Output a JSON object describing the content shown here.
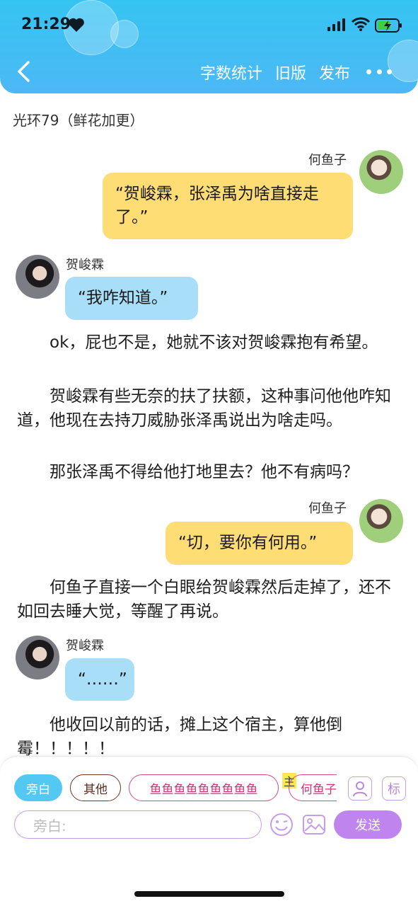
{
  "status_bar": {
    "time": "21:29"
  },
  "nav": {
    "links": [
      "字数统计",
      "旧版",
      "发布"
    ]
  },
  "chapter": {
    "title": "光环79（鲜花加更）"
  },
  "messages": [
    {
      "speaker": "何鱼子",
      "side": "right",
      "text": "“贺峻霖，张泽禹为啥直接走了。”"
    },
    {
      "speaker": "贺峻霖",
      "side": "left",
      "text": "“我咋知道。”"
    },
    {
      "speaker": "何鱼子",
      "side": "right",
      "text": "“切，要你有何用。”"
    },
    {
      "speaker": "贺峻霖",
      "side": "left",
      "text": "“……”"
    }
  ],
  "narration": [
    "ok，屁也不是，她就不该对贺峻霖抱有希望。",
    "贺峻霖有些无奈的扶了扶额，这种事问他他咋知道，他现在去持刀威胁张泽禹说出为啥走吗。",
    "那张泽禹不得给他打地里去？他不有病吗？",
    "何鱼子直接一个白眼给贺峻霖然后走掉了，还不如回去睡大觉，等醒了再说。",
    "他收回以前的话，摊上这个宿主，算他倒霉！！！！！"
  ],
  "composer": {
    "roles": [
      "旁白",
      "其他",
      "鱼鱼鱼鱼鱼鱼鱼鱼鱼",
      "何鱼子"
    ],
    "main_tag": "主",
    "mark_label": "标",
    "placeholder": "旁白:",
    "send_label": "发送"
  },
  "colors": {
    "header": "#3ec0f3",
    "bubble_yellow": "#fedd74",
    "bubble_blue": "#a9def8",
    "send": "#c084ef"
  }
}
